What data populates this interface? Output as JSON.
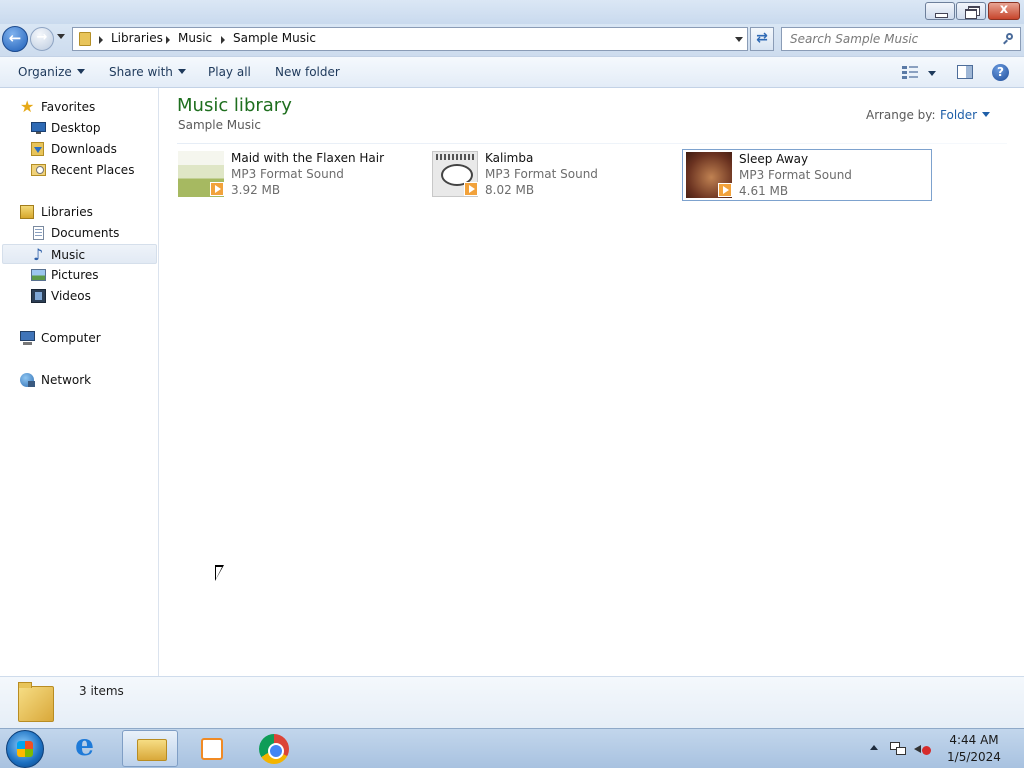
{
  "titlebar": {
    "controls": {
      "close_glyph": "x"
    }
  },
  "addressbar": {
    "breadcrumbs": [
      "Libraries",
      "Music",
      "Sample Music"
    ]
  },
  "search": {
    "placeholder": "Search Sample Music"
  },
  "toolbar": {
    "organize_label": "Organize",
    "share_label": "Share with",
    "playall_label": "Play all",
    "newfolder_label": "New folder"
  },
  "sidebar": {
    "favorites": {
      "label": "Favorites",
      "items": [
        "Desktop",
        "Downloads",
        "Recent Places"
      ]
    },
    "libraries": {
      "label": "Libraries",
      "items": [
        "Documents",
        "Music",
        "Pictures",
        "Videos"
      ],
      "selected": "Music"
    },
    "computer": "Computer",
    "network": "Network"
  },
  "main": {
    "title": "Music library",
    "subtitle": "Sample Music",
    "arrange_label": "Arrange by:",
    "arrange_value": "Folder",
    "files": [
      {
        "name": "Maid with the Flaxen Hair",
        "type": "MP3 Format Sound",
        "size": "3.92 MB",
        "selected": false
      },
      {
        "name": "Kalimba",
        "type": "MP3 Format Sound",
        "size": "8.02 MB",
        "selected": false
      },
      {
        "name": "Sleep Away",
        "type": "MP3 Format Sound",
        "size": "4.61 MB",
        "selected": true
      }
    ]
  },
  "details": {
    "item_count": "3 items"
  },
  "taskbar": {
    "time": "4:44 AM",
    "date": "1/5/2024",
    "apps": [
      "internet-explorer",
      "windows-explorer",
      "media-player",
      "chrome"
    ],
    "active_app": "windows-explorer"
  },
  "colors": {
    "library_title": "#1e6e1e",
    "link_blue": "#1f5fa8",
    "selection_border": "#7da2ce"
  }
}
